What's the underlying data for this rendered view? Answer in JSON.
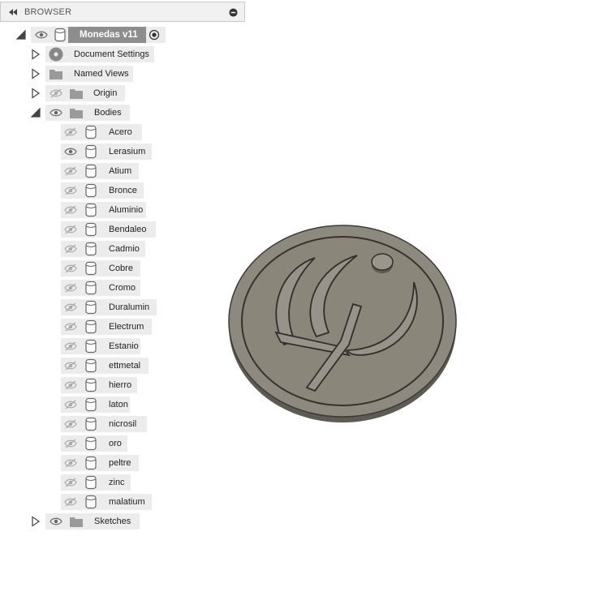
{
  "panel": {
    "title": "BROWSER"
  },
  "root": {
    "label": "Monedas v11"
  },
  "folders": [
    {
      "key": "doc-settings",
      "label": "Document Settings",
      "icon": "gear-icon",
      "visible": null
    },
    {
      "key": "named-views",
      "label": "Named Views",
      "icon": "folder-icon",
      "visible": null
    },
    {
      "key": "origin",
      "label": "Origin",
      "icon": "folder-icon",
      "visible": false
    }
  ],
  "bodies_folder": {
    "label": "Bodies",
    "visible": true
  },
  "bodies": [
    {
      "label": "Acero",
      "visible": false
    },
    {
      "label": "Lerasium",
      "visible": true
    },
    {
      "label": "Atium",
      "visible": false
    },
    {
      "label": "Bronce",
      "visible": false
    },
    {
      "label": "Aluminio",
      "visible": false
    },
    {
      "label": "Bendaleo",
      "visible": false
    },
    {
      "label": "Cadmio",
      "visible": false
    },
    {
      "label": "Cobre",
      "visible": false
    },
    {
      "label": "Cromo",
      "visible": false
    },
    {
      "label": "Duralumin",
      "visible": false
    },
    {
      "label": "Electrum",
      "visible": false
    },
    {
      "label": "Estanio",
      "visible": false
    },
    {
      "label": "ettmetal",
      "visible": false
    },
    {
      "label": "hierro",
      "visible": false
    },
    {
      "label": "laton",
      "visible": false
    },
    {
      "label": "nicrosil",
      "visible": false
    },
    {
      "label": "oro",
      "visible": false
    },
    {
      "label": "peltre",
      "visible": false
    },
    {
      "label": "zinc",
      "visible": false
    },
    {
      "label": "malatium",
      "visible": false
    }
  ],
  "sketches_folder": {
    "label": "Sketches",
    "visible": true
  },
  "colors": {
    "root_chip": "#8d8d8d",
    "chip": "#ececec",
    "model": "#8b877c"
  }
}
